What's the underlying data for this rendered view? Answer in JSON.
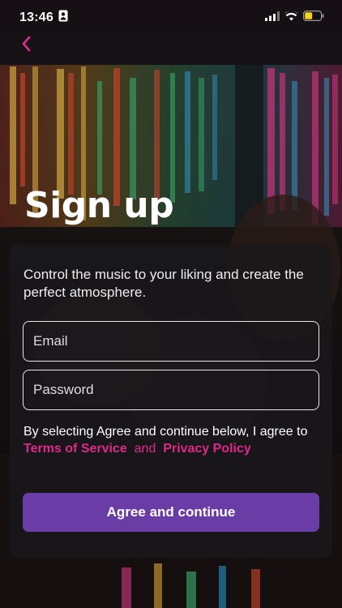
{
  "status_bar": {
    "time": "13:46"
  },
  "screen": {
    "title": "Sign up"
  },
  "card": {
    "description": "Control the music to your liking and create the perfect atmosphere.",
    "email_placeholder": "Email",
    "password_placeholder": "Password",
    "terms_prefix": "By selecting Agree and continue below, I agree to",
    "terms_link": "Terms of Service",
    "terms_and": "and",
    "privacy_link": "Privacy Policy",
    "button_label": "Agree and continue"
  },
  "colors": {
    "accent": "#e0288c",
    "button": "#6a3ca5",
    "back_chevron": "#e0288c",
    "battery_fill": "#f4d21f"
  },
  "icons": [
    "person-badge-icon",
    "signal-icon",
    "wifi-icon",
    "battery-icon",
    "chevron-left-icon"
  ]
}
